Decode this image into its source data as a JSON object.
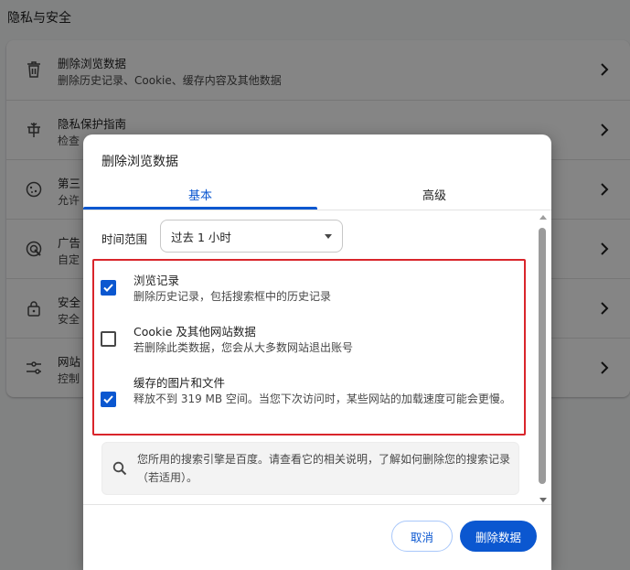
{
  "section_title": "隐私与安全",
  "settings_rows": [
    {
      "icon": "trash-icon",
      "title": "删除浏览数据",
      "subtitle": "删除历史记录、Cookie、缓存内容及其他数据"
    },
    {
      "icon": "privacy-guide-icon",
      "title": "隐私保护指南",
      "subtitle": "检查"
    },
    {
      "icon": "cookie-icon",
      "title": "第三",
      "subtitle": "允许"
    },
    {
      "icon": "ad-privacy-icon",
      "title": "广告",
      "subtitle": "自定"
    },
    {
      "icon": "lock-icon",
      "title": "安全",
      "subtitle": "安全"
    },
    {
      "icon": "tune-icon",
      "title": "网站",
      "subtitle": "控制"
    }
  ],
  "dialog": {
    "title": "删除浏览数据",
    "tabs": [
      {
        "label": "基本",
        "selected": true
      },
      {
        "label": "高级",
        "selected": false
      }
    ],
    "time_range": {
      "label": "时间范围",
      "value": "过去 1 小时"
    },
    "options": [
      {
        "title": "浏览记录",
        "subtitle": "删除历史记录，包括搜索框中的历史记录",
        "checked": true
      },
      {
        "title": "Cookie 及其他网站数据",
        "subtitle": "若删除此类数据，您会从大多数网站退出账号",
        "checked": false
      },
      {
        "title": "缓存的图片和文件",
        "subtitle": "释放不到 319 MB 空间。当您下次访问时，某些网站的加载速度可能会更慢。",
        "checked": true
      }
    ],
    "info_text": "您所用的搜索引擎是百度。请查看它的相关说明，了解如何删除您的搜索记录（若适用）。",
    "cancel_label": "取消",
    "delete_label": "删除数据"
  },
  "colors": {
    "accent": "#0b57d0",
    "highlight_border": "#d9252b",
    "overlay": "rgba(0,0,0,0.48)"
  }
}
